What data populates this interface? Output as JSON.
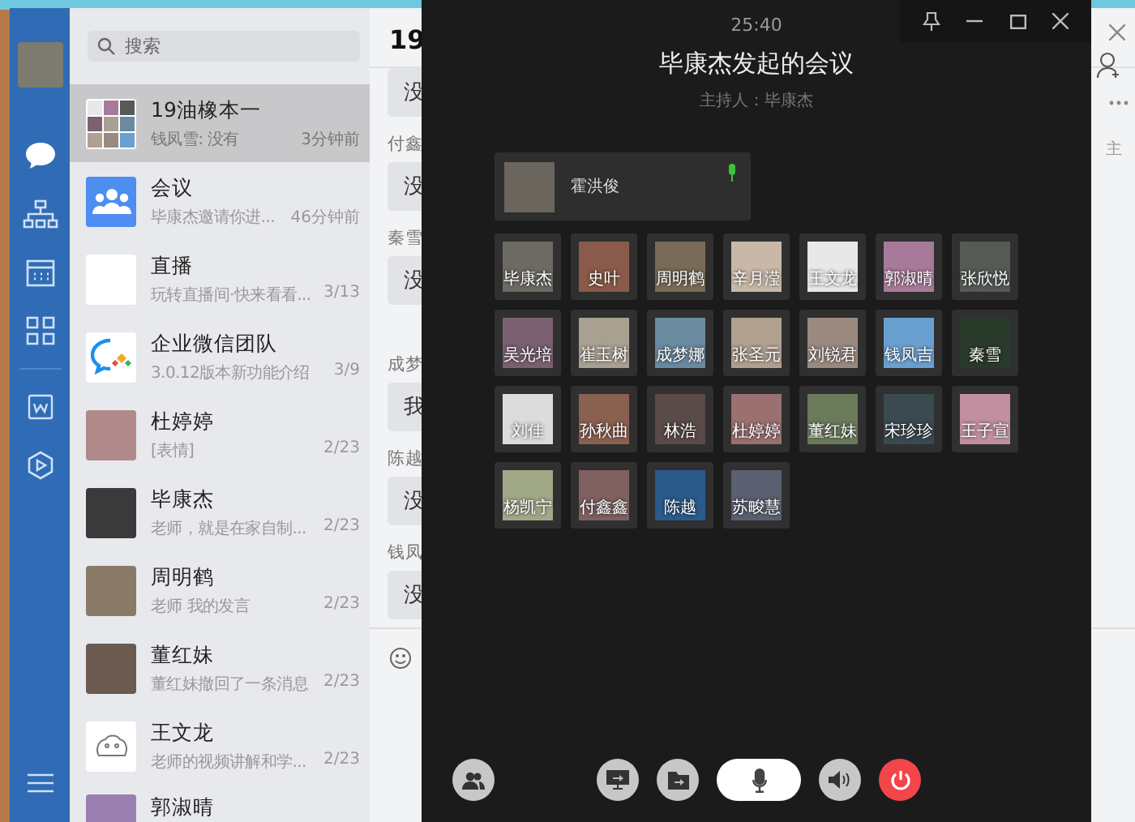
{
  "nav": {
    "items": [
      {
        "selected": true
      },
      {
        "selected": false
      },
      {
        "selected": false
      },
      {
        "selected": false
      },
      {
        "selected": false
      },
      {
        "selected": false
      }
    ]
  },
  "search": {
    "placeholder": "搜索"
  },
  "chats": [
    {
      "kind": "group",
      "name": "19油橡本一",
      "preview": "钱凤雪: 没有",
      "time": "3分钟前",
      "selected": true
    },
    {
      "kind": "meeting",
      "name": "会议",
      "preview": "毕康杰邀请你进...",
      "time": "46分钟前",
      "selected": false
    },
    {
      "kind": "blank",
      "name": "直播",
      "preview": "玩转直播间·快来看看...",
      "time": "3/13",
      "selected": false
    },
    {
      "kind": "wecom",
      "name": "企业微信团队",
      "preview": "3.0.12版本新功能介绍",
      "time": "3/9",
      "selected": false
    },
    {
      "kind": "photo",
      "name": "杜婷婷",
      "preview": "[表情]",
      "time": "2/23",
      "selected": false
    },
    {
      "kind": "photo",
      "name": "毕康杰",
      "preview": "老师，就是在家自制...",
      "time": "2/23",
      "selected": false
    },
    {
      "kind": "photo",
      "name": "周明鹤",
      "preview": "老师  我的发言",
      "time": "2/23",
      "selected": false
    },
    {
      "kind": "photo",
      "name": "董红妹",
      "preview": "董红妹撤回了一条消息",
      "time": "2/23",
      "selected": false
    },
    {
      "kind": "sketch",
      "name": "王文龙",
      "preview": "老师的视频讲解和学...",
      "time": "2/23",
      "selected": false
    },
    {
      "kind": "photo",
      "name": "郭淑晴",
      "selected": false
    }
  ],
  "chat_panel": {
    "title": "19",
    "messages": [
      {
        "text": "没"
      },
      {
        "sender": "付鑫",
        "text": "没"
      },
      {
        "sender": "秦雪",
        "text": "没"
      },
      {
        "sender": "成梦",
        "text": "我"
      },
      {
        "sender": "陈越",
        "text": "没"
      },
      {
        "sender": "钱凤",
        "text": "没"
      }
    ],
    "side_label": "主"
  },
  "meeting": {
    "timer": "25:40",
    "title": "毕康杰发起的会议",
    "host": "主持人：毕康杰",
    "speaker": {
      "name": "霍洪俊",
      "mic_on": true
    },
    "participants": [
      "毕康杰",
      "史叶",
      "周明鹤",
      "辛月滢",
      "王文龙",
      "郭淑晴",
      "张欣悦",
      "吴光培",
      "崔玉树",
      "成梦娜",
      "张圣元",
      "刘锐君",
      "钱凤吉",
      "秦雪",
      "刘佳",
      "孙秋曲",
      "林浩",
      "杜婷婷",
      "董红妹",
      "宋珍珍",
      "王子宣",
      "杨凯宁",
      "付鑫鑫",
      "陈越",
      "苏畯慧"
    ],
    "controls": [
      {
        "kind": "members"
      },
      {
        "kind": "screen"
      },
      {
        "kind": "file"
      },
      {
        "kind": "mic",
        "on": true
      },
      {
        "kind": "speaker"
      },
      {
        "kind": "hangup"
      }
    ]
  }
}
